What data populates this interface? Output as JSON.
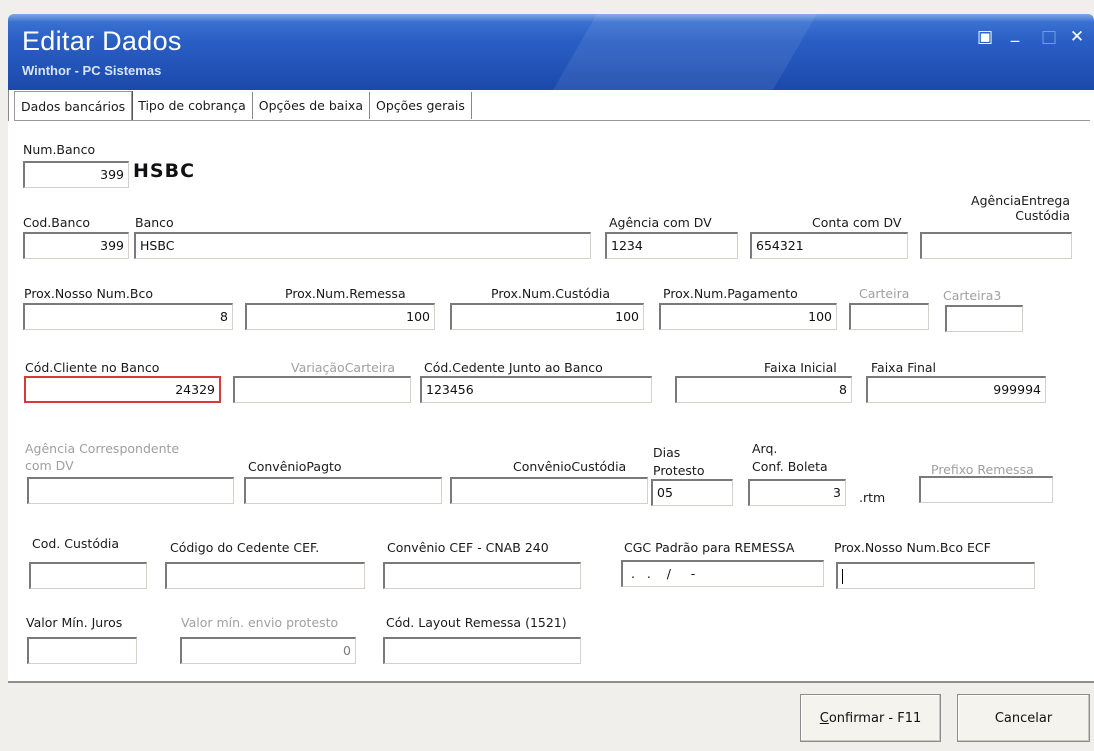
{
  "window": {
    "title": "Editar Dados",
    "subtitle": "Winthor - PC Sistemas",
    "controls": {
      "restore": "▣",
      "minimize": "_",
      "maximize": "□",
      "close": "✕"
    }
  },
  "tabs": [
    "Dados bancários",
    "Tipo de cobrança",
    "Opções de baixa",
    "Opções gerais"
  ],
  "row1": {
    "num_banco_label": "Num.Banco",
    "num_banco_value": "399",
    "bank_name": "HSBC"
  },
  "row2": {
    "cod_banco_label": "Cod.Banco",
    "cod_banco_value": "399",
    "banco_label": "Banco",
    "banco_value": "HSBC",
    "agencia_label": "Agência com DV",
    "agencia_value": "1234",
    "conta_label": "Conta com DV",
    "conta_value": "654321",
    "agencia_entrega_label_1": "AgênciaEntrega",
    "agencia_entrega_label_2": "Custódia",
    "agencia_entrega_value": ""
  },
  "row3": {
    "prox_nosso_label": "Prox.Nosso Num.Bco",
    "prox_nosso_value": "8",
    "prox_remessa_label": "Prox.Num.Remessa",
    "prox_remessa_value": "100",
    "prox_custodia_label": "Prox.Num.Custódia",
    "prox_custodia_value": "100",
    "prox_pagamento_label": "Prox.Num.Pagamento",
    "prox_pagamento_value": "100",
    "carteira_label": "Carteira",
    "carteira_value": "",
    "carteira3_label": "Carteira3",
    "carteira3_value": ""
  },
  "row4": {
    "cod_cliente_label": "Cód.Cliente no Banco",
    "cod_cliente_value": "24329",
    "variacao_label": "VariaçãoCarteira",
    "variacao_value": "",
    "cod_cedente_label": "Cód.Cedente Junto ao Banco",
    "cod_cedente_value": "123456",
    "faixa_inicial_label": "Faixa Inicial",
    "faixa_inicial_value": "8",
    "faixa_final_label": "Faixa Final",
    "faixa_final_value": "999994"
  },
  "row5": {
    "agencia_corr_label_1": "Agência Correspondente",
    "agencia_corr_label_2": "com DV",
    "agencia_corr_value": "",
    "convenio_pagto_label": "ConvênioPagto",
    "convenio_pagto_value": "",
    "convenio_custodia_label": "ConvênioCustódia",
    "convenio_custodia_value": "",
    "dias_protesto_label_1": "Dias",
    "dias_protesto_label_2": "Protesto",
    "dias_protesto_value": "05",
    "arq_conf_label_1": "Arq.",
    "arq_conf_label_2": "Conf. Boleta",
    "arq_conf_value": "3",
    "arq_conf_suffix": ".rtm",
    "prefixo_remessa_label": "Prefixo Remessa",
    "prefixo_remessa_value": ""
  },
  "row6": {
    "cod_custodia_label": "Cod. Custódia",
    "cod_custodia_value": "",
    "codigo_cedente_cef_label": "Código do Cedente CEF.",
    "codigo_cedente_cef_value": "",
    "convenio_cef_label": "Convênio CEF - CNAB 240",
    "convenio_cef_value": "",
    "cgc_label": "CGC Padrão para REMESSA",
    "cgc_value": " .   .    /     -",
    "prox_nosso_ecf_label": "Prox.Nosso Num.Bco ECF",
    "prox_nosso_ecf_value": ""
  },
  "row7": {
    "valor_min_juros_label": "Valor Mín. Juros",
    "valor_min_juros_value": "",
    "valor_min_envio_label": "Valor mín. envio protesto",
    "valor_min_envio_value": "0",
    "cod_layout_label": "Cód. Layout Remessa (1521)",
    "cod_layout_value": ""
  },
  "footer": {
    "confirm_hotkey": "C",
    "confirm_rest": "onfirmar - F11",
    "cancel_label": "Cancelar"
  }
}
